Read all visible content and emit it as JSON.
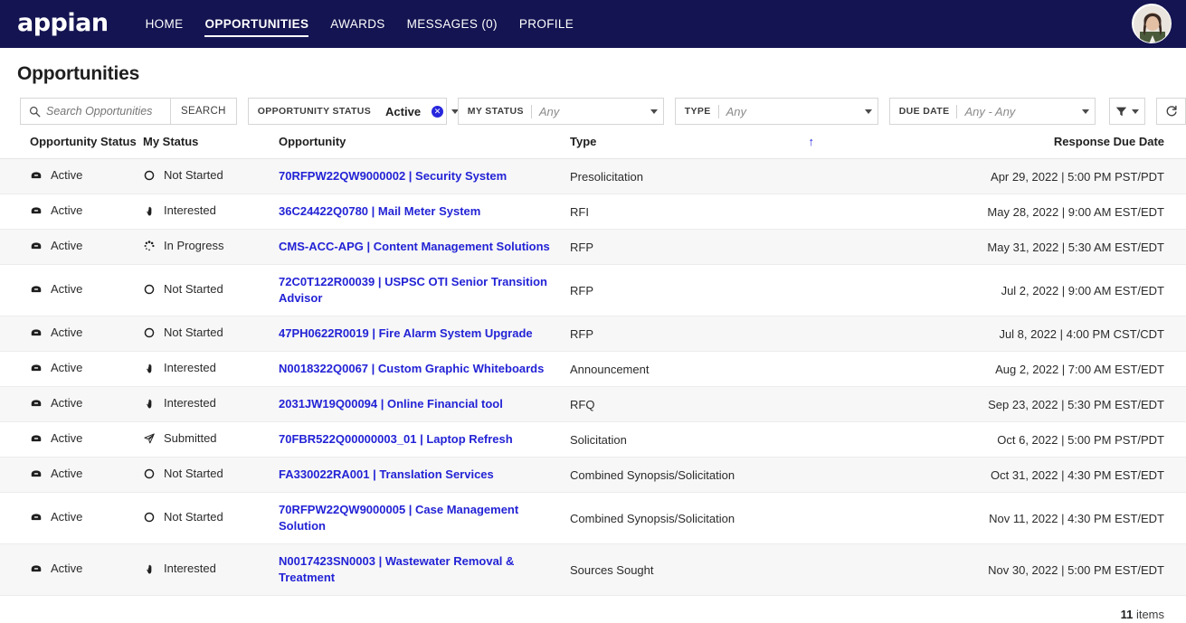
{
  "nav": {
    "brand": "appian",
    "items": [
      {
        "label": "HOME",
        "active": false
      },
      {
        "label": "OPPORTUNITIES",
        "active": true
      },
      {
        "label": "AWARDS",
        "active": false
      },
      {
        "label": "MESSAGES (0)",
        "active": false
      },
      {
        "label": "PROFILE",
        "active": false
      }
    ],
    "avatar_icon": "user-avatar-photo"
  },
  "page": {
    "title": "Opportunities"
  },
  "search": {
    "placeholder": "Search Opportunities",
    "value": "",
    "button_label": "SEARCH",
    "icon": "search-icon"
  },
  "filters": [
    {
      "label": "OPPORTUNITY STATUS",
      "value": "Active",
      "is_placeholder": false,
      "clearable": true
    },
    {
      "label": "MY STATUS",
      "value": "Any",
      "is_placeholder": true,
      "clearable": false
    },
    {
      "label": "TYPE",
      "value": "Any",
      "is_placeholder": true,
      "clearable": false
    },
    {
      "label": "DUE DATE",
      "value": "Any - Any",
      "is_placeholder": true,
      "clearable": false
    }
  ],
  "toolbar": {
    "filter_icon": "funnel-icon",
    "refresh_icon": "refresh-icon"
  },
  "table": {
    "columns": [
      {
        "key": "status",
        "label": "Opportunity Status"
      },
      {
        "key": "my_status",
        "label": "My Status"
      },
      {
        "key": "opportunity",
        "label": "Opportunity"
      },
      {
        "key": "type",
        "label": "Type"
      },
      {
        "key": "due",
        "label": "Response Due Date"
      }
    ],
    "sort": {
      "column": "Response Due Date",
      "direction": "asc",
      "indicator": "↑"
    },
    "rows": [
      {
        "status": "Active",
        "status_icon": "inbox-icon",
        "my_status": "Not Started",
        "my_status_icon": "circle-icon",
        "opportunity": "70RFPW22QW9000002 | Security System",
        "type": "Presolicitation",
        "due": "Apr 29, 2022 | 5:00 PM PST/PDT"
      },
      {
        "status": "Active",
        "status_icon": "inbox-icon",
        "my_status": "Interested",
        "my_status_icon": "hand-icon",
        "opportunity": "36C24422Q0780 | Mail Meter System",
        "type": "RFI",
        "due": "May 28, 2022 | 9:00 AM EST/EDT"
      },
      {
        "status": "Active",
        "status_icon": "inbox-icon",
        "my_status": "In Progress",
        "my_status_icon": "spinner-icon",
        "opportunity": "CMS-ACC-APG | Content Management Solutions",
        "type": "RFP",
        "due": "May 31, 2022 | 5:30 AM EST/EDT"
      },
      {
        "status": "Active",
        "status_icon": "inbox-icon",
        "my_status": "Not Started",
        "my_status_icon": "circle-icon",
        "opportunity": "72C0T122R00039 | USPSC OTI Senior Transition Advisor",
        "type": "RFP",
        "due": "Jul 2, 2022 | 9:00 AM EST/EDT"
      },
      {
        "status": "Active",
        "status_icon": "inbox-icon",
        "my_status": "Not Started",
        "my_status_icon": "circle-icon",
        "opportunity": "47PH0622R0019 | Fire Alarm System Upgrade",
        "type": "RFP",
        "due": "Jul 8, 2022 | 4:00 PM CST/CDT"
      },
      {
        "status": "Active",
        "status_icon": "inbox-icon",
        "my_status": "Interested",
        "my_status_icon": "hand-icon",
        "opportunity": "N0018322Q0067 | Custom Graphic Whiteboards",
        "type": "Announcement",
        "due": "Aug 2, 2022 | 7:00 AM EST/EDT"
      },
      {
        "status": "Active",
        "status_icon": "inbox-icon",
        "my_status": "Interested",
        "my_status_icon": "hand-icon",
        "opportunity": "2031JW19Q00094 | Online Financial tool",
        "type": "RFQ",
        "due": "Sep 23, 2022 | 5:30 PM EST/EDT"
      },
      {
        "status": "Active",
        "status_icon": "inbox-icon",
        "my_status": "Submitted",
        "my_status_icon": "paper-plane-icon",
        "opportunity": "70FBR522Q00000003_01 | Laptop Refresh",
        "type": "Solicitation",
        "due": "Oct 6, 2022 | 5:00 PM PST/PDT"
      },
      {
        "status": "Active",
        "status_icon": "inbox-icon",
        "my_status": "Not Started",
        "my_status_icon": "circle-icon",
        "opportunity": "FA330022RA001 | Translation Services",
        "type": "Combined Synopsis/Solicitation",
        "due": "Oct 31, 2022 | 4:30 PM EST/EDT"
      },
      {
        "status": "Active",
        "status_icon": "inbox-icon",
        "my_status": "Not Started",
        "my_status_icon": "circle-icon",
        "opportunity": "70RFPW22QW9000005 | Case Management Solution",
        "type": "Combined Synopsis/Solicitation",
        "due": "Nov 11, 2022 | 4:30 PM EST/EDT"
      },
      {
        "status": "Active",
        "status_icon": "inbox-icon",
        "my_status": "Interested",
        "my_status_icon": "hand-icon",
        "opportunity": "N0017423SN0003 | Wastewater Removal & Treatment",
        "type": "Sources Sought",
        "due": "Nov 30, 2022 | 5:00 PM EST/EDT"
      }
    ]
  },
  "footer": {
    "count": "11",
    "label": "items"
  },
  "colors": {
    "navbar": "#141452",
    "link": "#2323d6",
    "accent": "#2727dd",
    "row_alt": "#f7f7f7"
  }
}
